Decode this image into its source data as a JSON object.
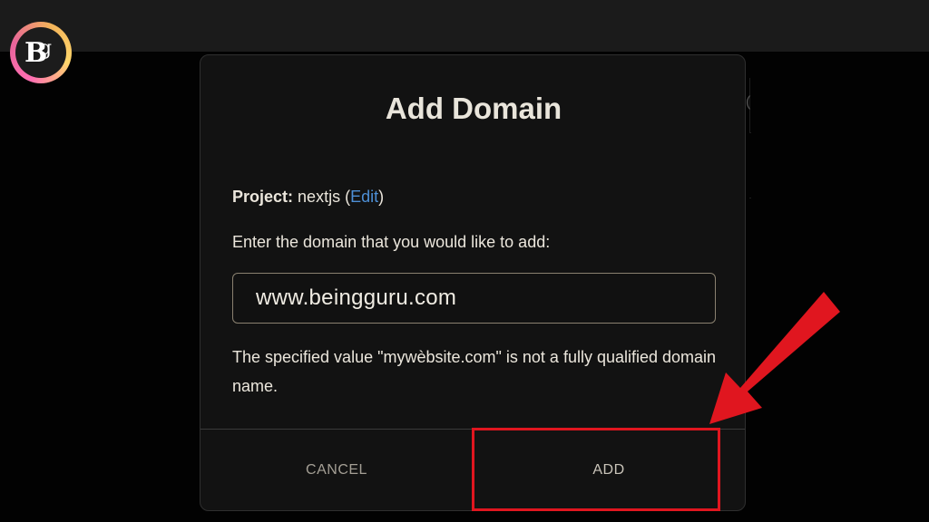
{
  "logo": {
    "text": "Bg",
    "colors": [
      "#ff6fb3",
      "#f2b35a"
    ]
  },
  "modal": {
    "title": "Add Domain",
    "project": {
      "label": "Project:",
      "name": "nextjs",
      "open_paren": " (",
      "edit_label": "Edit",
      "close_paren": ")"
    },
    "prompt": "Enter the domain that you would like to add:",
    "domain_input": {
      "value": "www.beingguru.com"
    },
    "error_message": "The specified value \"mywèbsite.com\" is not a fully qualified domain name.",
    "buttons": {
      "cancel_label": "CANCEL",
      "add_label": "ADD"
    }
  },
  "annotation": {
    "highlight_color": "#e0161f",
    "arrow_color": "#e0161f",
    "arrow_icon": "arrow-down-left-icon"
  },
  "background": {
    "glyph": "(",
    "topbar_color": "#1b1b1b"
  }
}
